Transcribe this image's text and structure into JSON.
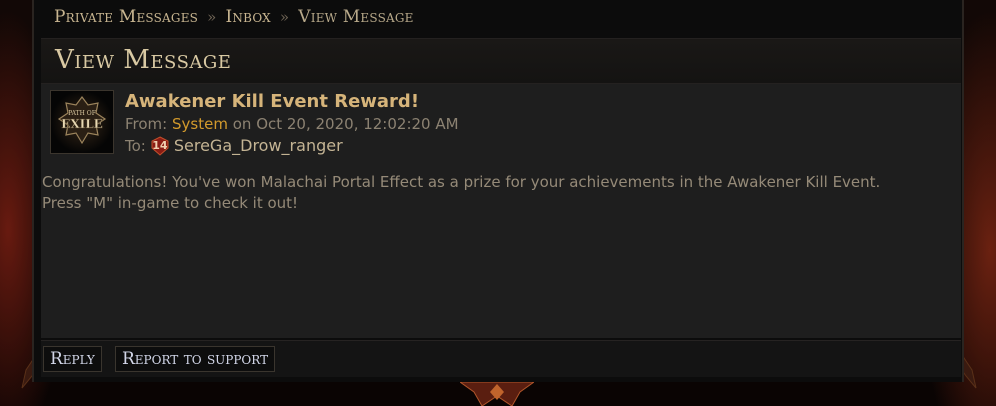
{
  "breadcrumb": {
    "items": [
      "Private Messages",
      "Inbox",
      "View Message"
    ]
  },
  "page": {
    "title": "View Message"
  },
  "message": {
    "subject": "Awakener Kill Event Reward!",
    "from_label": "From:",
    "sender": "System",
    "date_prefix": "on",
    "date": "Oct 20, 2020, 12:02:20 AM",
    "to_label": "To:",
    "recipient_level": "14",
    "recipient": "SereGa_Drow_ranger",
    "body": "Congratulations! You've won Malachai Portal Effect as a prize for your achievements in the Awakener Kill Event. Press \"M\" in-game to check it out!"
  },
  "avatar": {
    "icon": "path-of-exile-logo-icon",
    "logo_text_top": "PATH OF",
    "logo_text_main": "EXILE"
  },
  "actions": {
    "reply_label": "Reply",
    "report_label": "Report to support"
  },
  "colors": {
    "accent_gold": "#d6b47a",
    "sender_orange": "#d29a2c",
    "panel_bg": "#1e1e1e",
    "level_badge_red": "#8a1c14"
  }
}
